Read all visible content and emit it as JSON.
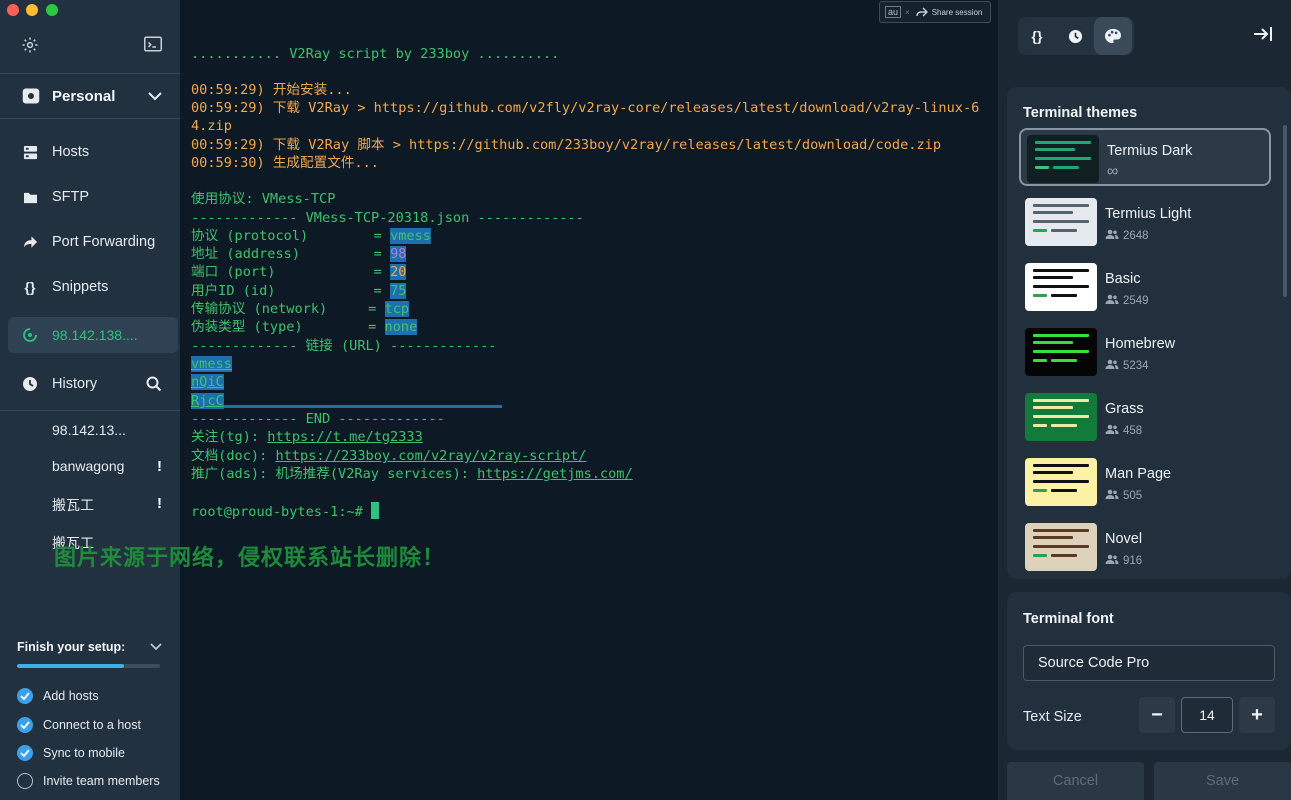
{
  "sidebar": {
    "vault_label": "Personal",
    "nav": [
      {
        "label": "Hosts",
        "icon": "hosts-icon"
      },
      {
        "label": "SFTP",
        "icon": "folder-icon"
      },
      {
        "label": "Port Forwarding",
        "icon": "forward-icon"
      },
      {
        "label": "Snippets",
        "icon": "braces-icon"
      }
    ],
    "active_host": "98.142.138....",
    "history_label": "History",
    "history_items": [
      {
        "label": "98.142.13...",
        "warn": ""
      },
      {
        "label": "banwagong",
        "warn": "!"
      },
      {
        "label": "搬瓦工",
        "warn": "!"
      },
      {
        "label": "搬瓦工",
        "warn": ""
      }
    ],
    "watermark": "图片来源于网络，侵权联系站长删除！",
    "setup": {
      "title": "Finish your setup:",
      "progress": 0.75,
      "items": [
        {
          "label": "Add hosts",
          "done": true
        },
        {
          "label": "Connect to a host",
          "done": true
        },
        {
          "label": "Sync to mobile",
          "done": true
        },
        {
          "label": "Invite team members",
          "done": false
        }
      ]
    }
  },
  "terminal": {
    "share": {
      "badge": "au",
      "close": "×",
      "label": "Share session"
    },
    "l1": "........... V2Ray script by 233boy ..........",
    "l2": "00:59:29) 开始安装...",
    "l3": "00:59:29) 下载 V2Ray > https://github.com/v2fly/v2ray-core/releases/latest/download/v2ray-linux-6",
    "l4": "4.zip",
    "l5": "00:59:29) 下载 V2Ray 脚本 > https://github.com/233boy/v2ray/releases/latest/download/code.zip",
    "l6": "00:59:30) 生成配置文件...",
    "l7": "使用协议: VMess-TCP",
    "l8": "------------- VMess-TCP-20318.json -------------",
    "kv": [
      {
        "key": "协议 (protocol)        = ",
        "val": "vmess"
      },
      {
        "key": "地址 (address)         = ",
        "val": "98"
      },
      {
        "key": "端口 (port)            = ",
        "val": "20"
      },
      {
        "key": "用户ID (id)            = ",
        "val": "75"
      },
      {
        "key": "传输协议 (network)     = ",
        "val": "tcp"
      },
      {
        "key": "伪装类型 (type)        = ",
        "val": "none"
      }
    ],
    "l15": "------------- 链接 (URL) -------------",
    "url_lines": [
      "vmess",
      "nQiC",
      "RjcC"
    ],
    "l19": "------------- END -------------",
    "l20_key": "关注(tg): ",
    "l20_val": "https://t.me/tg2333",
    "l21_key": "文档(doc): ",
    "l21_val": "https://233boy.com/v2ray/v2ray-script/",
    "l22_key": "推广(ads): 机场推荐(V2Ray services): ",
    "l22_val": "https://getjms.com/",
    "prompt": "root@proud-bytes-1:~# "
  },
  "panel": {
    "themes_title": "Terminal themes",
    "themes": [
      {
        "name": "Termius Dark",
        "count": "∞",
        "bg": "#0f1f22",
        "bar": "#21a776",
        "bar2": "#3cc27e"
      },
      {
        "name": "Termius Light",
        "count": "2648",
        "bg": "#e6eaee",
        "bar": "#56626e",
        "bar2": "#2ea055"
      },
      {
        "name": "Basic",
        "count": "2549",
        "bg": "#ffffff",
        "bar": "#111111",
        "bar2": "#2ea055"
      },
      {
        "name": "Homebrew",
        "count": "5234",
        "bg": "#050505",
        "bar": "#35e03a",
        "bar2": "#35e03a"
      },
      {
        "name": "Grass",
        "count": "458",
        "bg": "#127a3a",
        "bar": "#f3e9a6",
        "bar2": "#f3e9a6"
      },
      {
        "name": "Man Page",
        "count": "505",
        "bg": "#fbf2a5",
        "bar": "#111111",
        "bar2": "#2ea055"
      },
      {
        "name": "Novel",
        "count": "916",
        "bg": "#ded2bd",
        "bar": "#5a3a25",
        "bar2": "#2ea055"
      }
    ],
    "font_title": "Terminal font",
    "font_value": "Source Code Pro",
    "size_label": "Text Size",
    "size_value": "14",
    "minus": "−",
    "plus": "+",
    "cancel": "Cancel",
    "save": "Save"
  }
}
